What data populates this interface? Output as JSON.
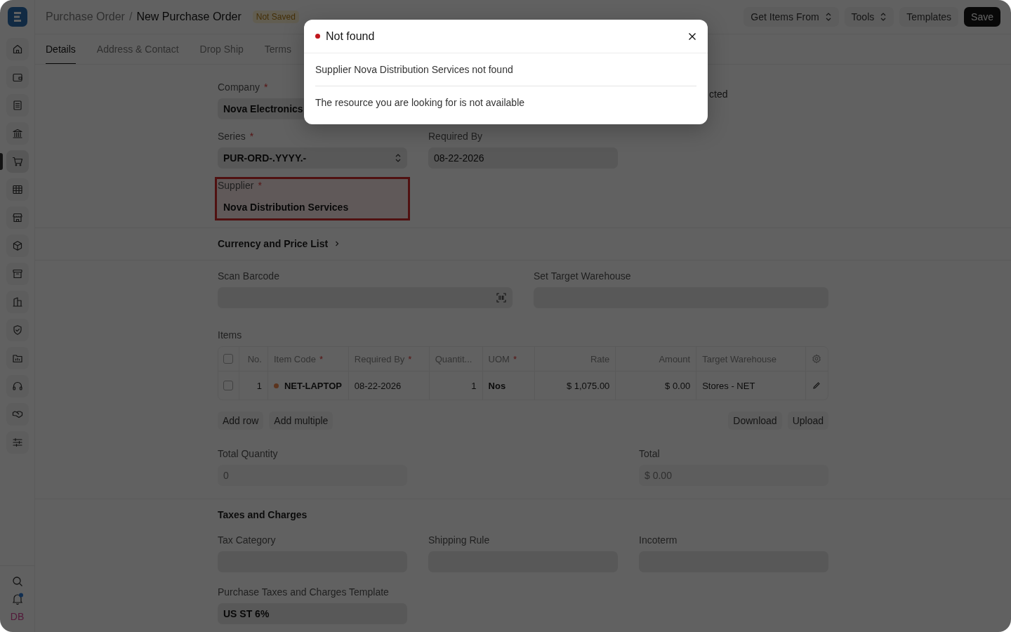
{
  "sidebar": {
    "items": [
      {
        "selected": false
      },
      {
        "selected": false
      },
      {
        "selected": false
      },
      {
        "selected": false
      },
      {
        "selected": true
      },
      {
        "selected": false
      },
      {
        "selected": false
      },
      {
        "selected": false
      },
      {
        "selected": false
      },
      {
        "selected": false
      },
      {
        "selected": false
      },
      {
        "selected": false
      },
      {
        "selected": false
      },
      {
        "selected": false
      },
      {
        "selected": false
      }
    ],
    "notification": true,
    "avatar": "DB"
  },
  "header": {
    "breadcrumb_parent": "Purchase Order",
    "separator": "/",
    "title": "New Purchase Order",
    "status": "Not Saved",
    "actions": [
      {
        "label": "Get Items From",
        "kind": "dropdown"
      },
      {
        "label": "Tools",
        "kind": "dropdown"
      },
      {
        "label": "Templates",
        "kind": "plain"
      },
      {
        "label": "Save",
        "kind": "primary"
      }
    ]
  },
  "tabs": [
    {
      "label": "Details",
      "selected": true
    },
    {
      "label": "Address & Contact",
      "selected": false
    },
    {
      "label": "Drop Ship",
      "selected": false
    },
    {
      "label": "Terms",
      "selected": false
    }
  ],
  "form": {
    "company": {
      "label": "Company",
      "required_mark": "*",
      "value": "Nova Electronics"
    },
    "subcontracted_label": "cted",
    "series": {
      "label": "Series",
      "required_mark": "*",
      "value": "PUR-ORD-.YYYY.-"
    },
    "required_by": {
      "label": "Required By",
      "value": "08-22-2026"
    },
    "supplier": {
      "label": "Supplier",
      "required_mark": "*",
      "value": "Nova Distribution Services",
      "error": true
    },
    "currency_section": {
      "title": "Currency and Price List",
      "expanded": false
    },
    "scan_barcode": {
      "label": "Scan Barcode"
    },
    "set_target_warehouse": {
      "label": "Set Target Warehouse"
    },
    "items": {
      "label": "Items",
      "select_all_checked": false,
      "columns": [
        {
          "label": "No."
        },
        {
          "label": "Item Code",
          "required_mark": "*"
        },
        {
          "label": "Required By",
          "required_mark": "*"
        },
        {
          "label": "Quantit..."
        },
        {
          "label": "UOM",
          "required_mark": "*"
        },
        {
          "label": "Rate"
        },
        {
          "label": "Amount"
        },
        {
          "label": "Target Warehouse"
        }
      ],
      "rows": [
        {
          "checked": false,
          "no": "1",
          "item_code": "NET-LAPTOP",
          "required_by": "08-22-2026",
          "quantity": "1",
          "uom": "Nos",
          "rate": "$ 1,075.00",
          "amount": "$ 0.00",
          "target_warehouse": "Stores - NET"
        }
      ],
      "left_buttons": [
        "Add row",
        "Add multiple"
      ],
      "right_buttons": [
        "Download",
        "Upload"
      ]
    },
    "total_quantity": {
      "label": "Total Quantity",
      "value": "0"
    },
    "total": {
      "label": "Total",
      "value": "$ 0.00"
    },
    "taxes_section": {
      "title": "Taxes and Charges"
    },
    "tax_fields": [
      {
        "label": "Tax Category"
      },
      {
        "label": "Shipping Rule"
      },
      {
        "label": "Incoterm"
      }
    ],
    "taxes_template": {
      "label": "Purchase Taxes and Charges Template",
      "value": "US ST 6%"
    }
  },
  "dialog": {
    "title": "Not found",
    "messages": [
      "Supplier Nova Distribution Services not found",
      "The resource you are looking for is not available"
    ]
  }
}
